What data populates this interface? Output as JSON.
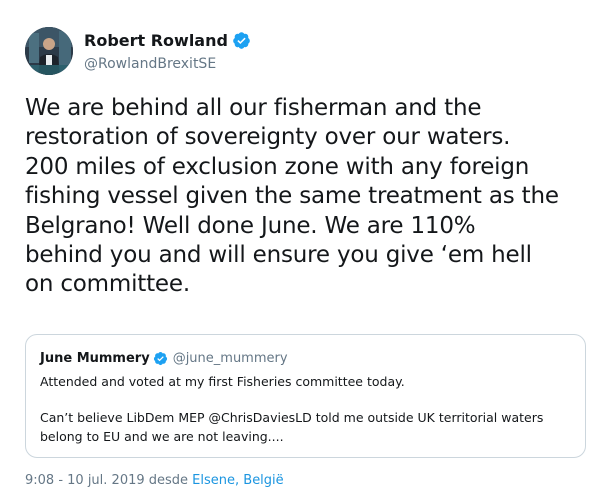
{
  "author": {
    "display_name": "Robert Rowland",
    "handle": "@RowlandBrexitSE",
    "verified": true
  },
  "tweet": {
    "lines": [
      "We are behind all our fisherman and the",
      "restoration of sovereignty over our waters.",
      "200 miles of exclusion zone with any foreign",
      "fishing vessel given the same treatment as the",
      "Belgrano! Well done June. We are 110%",
      "behind you and will ensure you give ‘em hell",
      "on committee."
    ]
  },
  "quoted_tweet": {
    "display_name": "June Mummery",
    "handle": "@june_mummery",
    "verified": true,
    "paragraph_1": "Attended and voted at my first Fisheries committee today.",
    "paragraph_2_line_1": "Can’t believe LibDem MEP @ChrisDaviesLD told me outside UK territorial waters",
    "paragraph_2_line_2": "belong to EU and we are not leaving...."
  },
  "meta": {
    "time": "9:08 - 10 jul. 2019 desde ",
    "location": "Elsene, België"
  },
  "colors": {
    "text": "#14171a",
    "secondary": "#657786",
    "link": "#1b95e0",
    "verified": "#1da1f2",
    "border": "#ccd6dd"
  }
}
